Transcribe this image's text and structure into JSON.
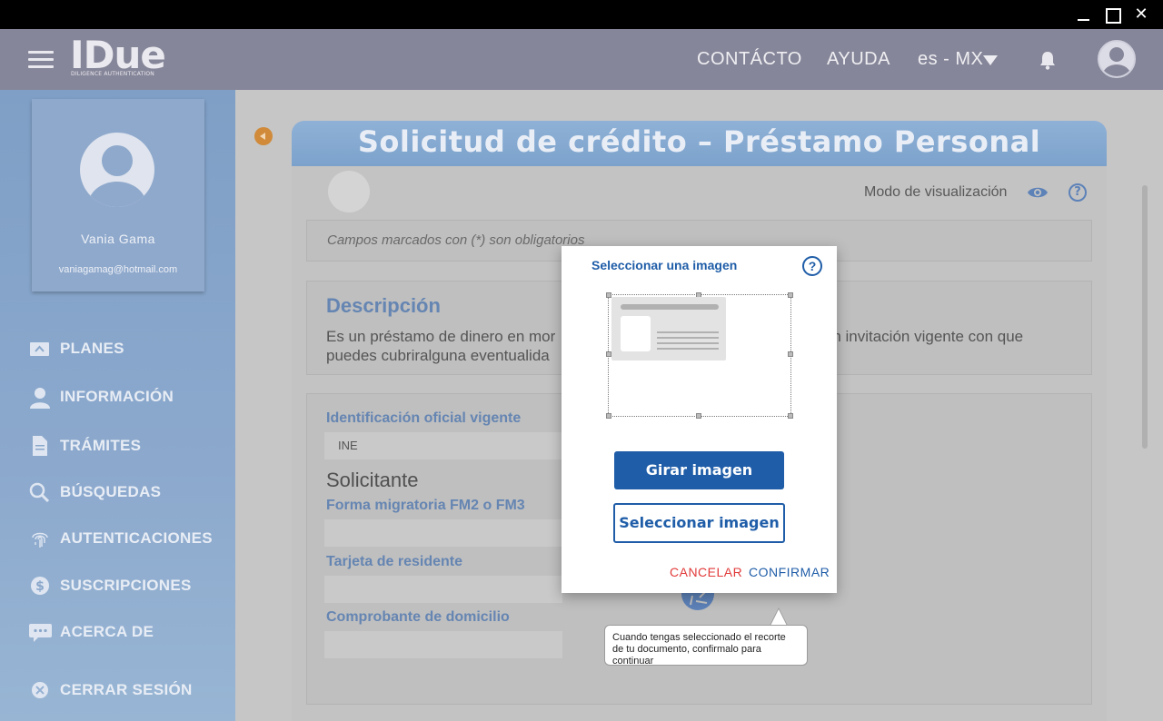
{
  "window": {
    "minimize": "",
    "maximize": "",
    "close_glyph": "✕"
  },
  "header": {
    "logo_text": "IDue",
    "logo_sub": "DILIGENCE AUTHENTICATION",
    "nav": {
      "contacto": "CONTÁCTO",
      "ayuda": "AYUDA",
      "language": "es - MX"
    },
    "icons": [
      "menu-icon",
      "bell-icon",
      "user-avatar-icon",
      "chevron-down-icon"
    ]
  },
  "sidebar": {
    "profile": {
      "name": "Vania Gama",
      "email": "vaniagamag@hotmail.com"
    },
    "items": [
      {
        "label": "PLANES",
        "icon": "plans-icon"
      },
      {
        "label": "INFORMACIÓN",
        "icon": "user-icon"
      },
      {
        "label": "TRÁMITES",
        "icon": "document-icon"
      },
      {
        "label": "BÚSQUEDAS",
        "icon": "search-icon"
      },
      {
        "label": "AUTENTICACIONES",
        "icon": "fingerprint-icon"
      },
      {
        "label": "SUSCRIPCIONES",
        "icon": "dollar-icon"
      },
      {
        "label": "ACERCA DE",
        "icon": "chat-icon"
      },
      {
        "label": "CERRAR SESIÓN",
        "icon": "close-circle-icon"
      }
    ]
  },
  "main": {
    "title": "Solicitud de crédito  – Préstamo Personal",
    "view_mode": "Modo de visualización",
    "help_glyph": "?",
    "required_note": "Campos marcados con (*) son obligatorios",
    "description": {
      "title": "Descripción",
      "text_left_1": "Es un préstamo de dinero en mor",
      "text_right_1": "n invitación vigente con que",
      "text_left_2": "puedes cubriralguna eventualida"
    },
    "form": {
      "id_label": "Identificación oficial vigente",
      "id_value": "INE",
      "section": "Solicitante",
      "fm_label": "Forma migratoria FM2 o FM3",
      "resident_label": "Tarjeta de residente",
      "address_label": "Comprobante de domicilio"
    }
  },
  "modal": {
    "title": "Seleccionar una imagen",
    "help_glyph": "?",
    "rotate_button": "Girar imagen",
    "select_button": "Seleccionar imagen",
    "cancel": "CANCELAR",
    "confirm": "CONFIRMAR"
  },
  "tooltip": {
    "text": "Cuando tengas seleccionado el recorte de tu documento, confirmalo para continuar"
  },
  "colors": {
    "accent": "#1f5da8",
    "cancel": "#e23a3a",
    "header": "#86869a",
    "sidebar": "#8ca9cd"
  }
}
